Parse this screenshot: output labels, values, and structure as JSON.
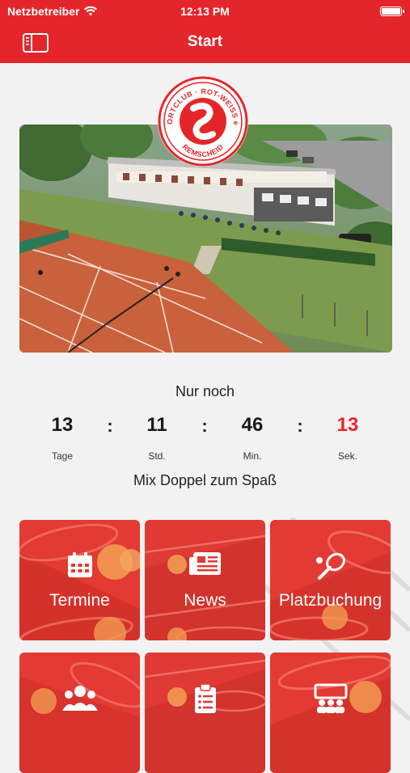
{
  "status_bar": {
    "carrier": "Netzbetreiber",
    "time": "12:13 PM"
  },
  "navbar": {
    "title": "Start"
  },
  "logo": {
    "top_text": "SPORTCLUB · ROT-WEISS e.V.",
    "bottom_text": "REMSCHEID"
  },
  "countdown": {
    "title": "Nur noch",
    "days": "13",
    "days_label": "Tage",
    "hours": "11",
    "hours_label": "Std.",
    "minutes": "46",
    "minutes_label": "Min.",
    "seconds": "13",
    "seconds_label": "Sek.",
    "separator": ":"
  },
  "event": {
    "name": "Mix Doppel zum Spaß"
  },
  "tiles": [
    {
      "label": "Termine",
      "icon": "calendar-icon"
    },
    {
      "label": "News",
      "icon": "newspaper-icon"
    },
    {
      "label": "Platzbuchung",
      "icon": "racket-ball-icon"
    },
    {
      "label": "",
      "icon": "group-icon"
    },
    {
      "label": "",
      "icon": "clipboard-icon"
    },
    {
      "label": "",
      "icon": "team-board-icon"
    }
  ],
  "colors": {
    "brand_red": "#e4262b",
    "clay": "#c9613c",
    "background": "#f2f2f2"
  }
}
